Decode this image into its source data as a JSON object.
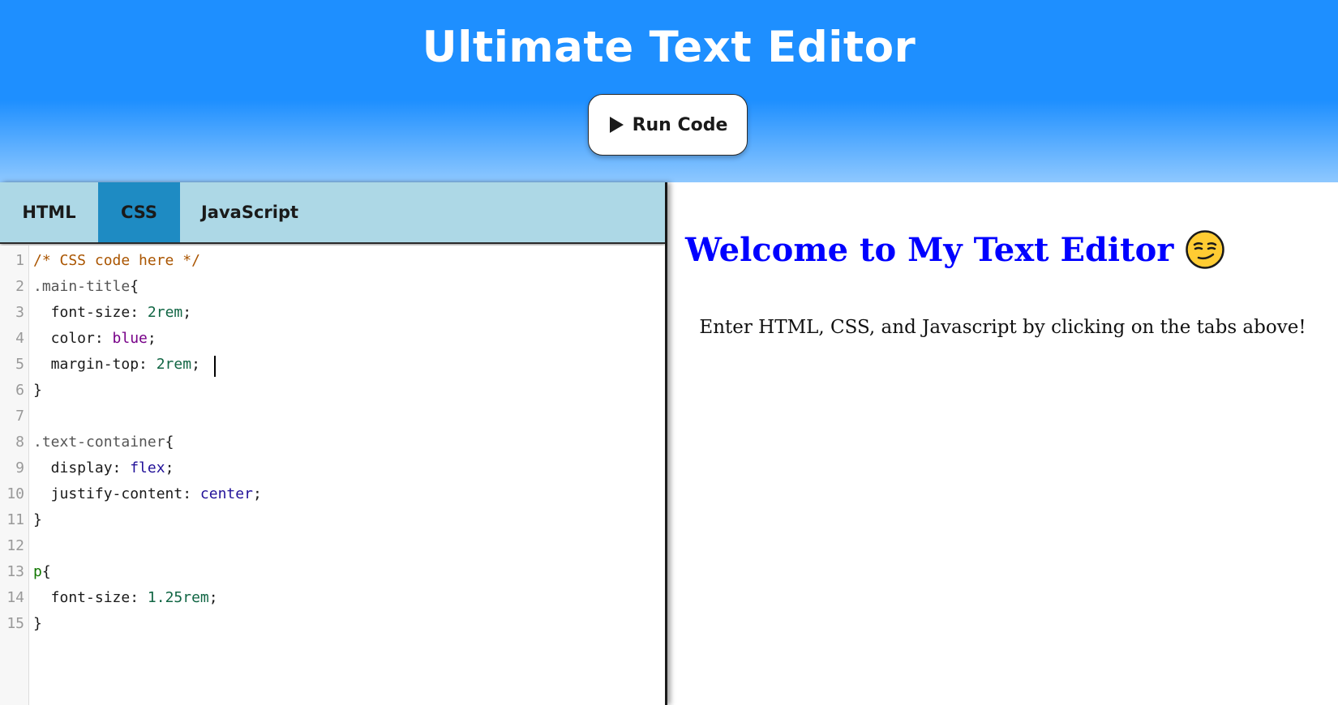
{
  "header": {
    "title": "Ultimate Text Editor",
    "run_button": {
      "label": "Run Code",
      "icon": "play-icon"
    }
  },
  "colors": {
    "header_blue": "#1e8fff",
    "tab_bar": "#add8e6",
    "active_tab": "#1e8bc3",
    "preview_title": "#0000ff"
  },
  "editor": {
    "tabs": [
      {
        "label": "HTML",
        "active": false
      },
      {
        "label": "CSS",
        "active": true
      },
      {
        "label": "JavaScript",
        "active": false
      }
    ],
    "line_numbers": [
      "1",
      "2",
      "3",
      "4",
      "5",
      "6",
      "7",
      "8",
      "9",
      "10",
      "11",
      "12",
      "13",
      "14",
      "15"
    ],
    "code": {
      "l1": "/* CSS code here */",
      "l2_sel": ".main-title",
      "l2_brace": "{",
      "l3_prop": "  font-size: ",
      "l3_val": "2rem",
      "l4_prop": "  color: ",
      "l4_val": "blue",
      "l5_prop": "  margin-top: ",
      "l5_val": "2rem",
      "l6": "}",
      "l8_sel": ".text-container",
      "l8_brace": "{",
      "l9_prop": "  display: ",
      "l9_val": "flex",
      "l10_prop": "  justify-content: ",
      "l10_val": "center",
      "l11": "}",
      "l13_sel": "p",
      "l13_brace": "{",
      "l14_prop": "  font-size: ",
      "l14_val": "1.25rem",
      "l15": "}",
      "semi": ";"
    }
  },
  "preview": {
    "title": "Welcome to My Text Editor",
    "title_emoji": "smirk-face-icon",
    "text": "Enter HTML, CSS, and Javascript by clicking on the tabs above!"
  }
}
